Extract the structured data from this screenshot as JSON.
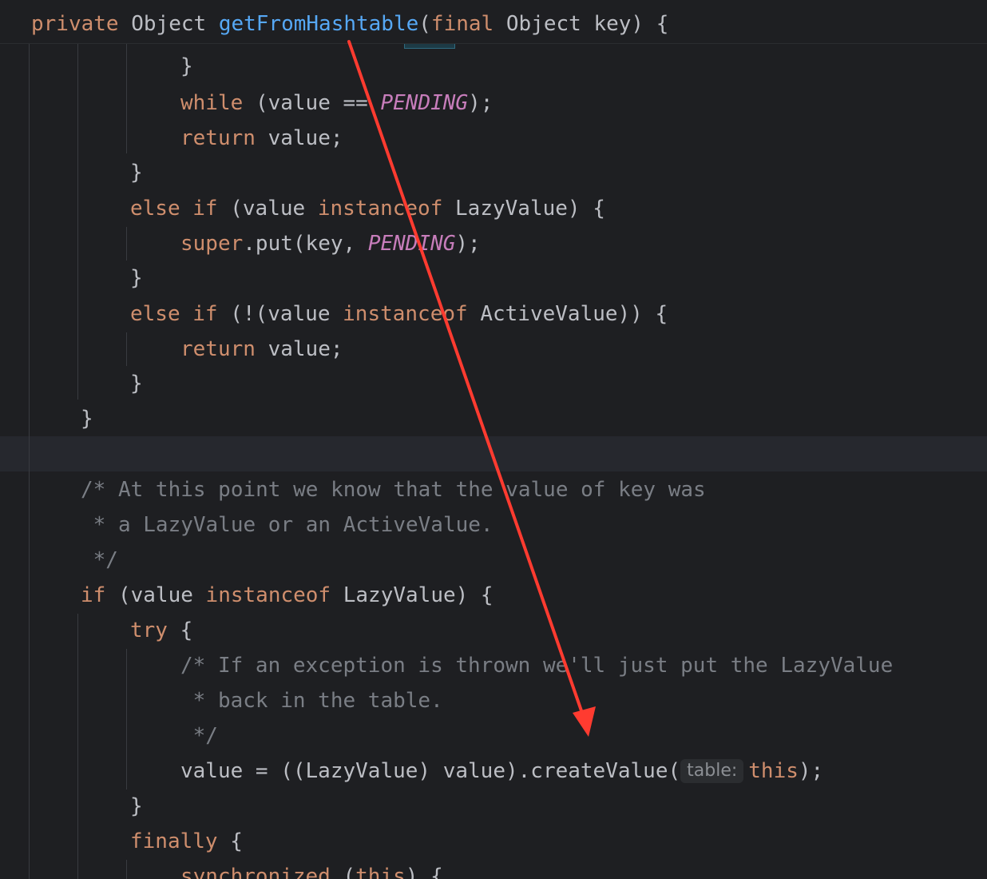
{
  "tokens": {
    "private": "private",
    "object": "Object",
    "method_name": "getFromHashtable",
    "open_paren": "(",
    "final": "final",
    "key": "key",
    "sig_close": ") {",
    "close_brace": "}",
    "while": "while",
    "value_eq": "(value ==",
    "pending": "PENDING",
    "paren_semi": ");",
    "return": "return",
    "value_semi": "value;",
    "else": "else",
    "if": "if",
    "paren_value": "(value",
    "instanceof": "instanceof",
    "lazyvalue_open": "LazyValue) {",
    "super": "super",
    "put_call": ".put(key,",
    "paren_not_value": "(!(value",
    "activevalue_open": "ActiveValue)) {",
    "comment_1": "/* At this point we know that the value of key was",
    "comment_2": " * a LazyValue or an ActiveValue.",
    "comment_3": " */",
    "try_word": "try",
    "open_brace": "{",
    "comment_4": "/* If an exception is thrown we'll just put the LazyValue",
    "comment_5": " * back in the table.",
    "comment_6": " */",
    "create_value_call": "value = ((LazyValue) value).createValue(",
    "param_hint": "table:",
    "this_word": "this",
    "finally_word": "finally",
    "synchronized_word": "synchronized",
    "paren_this": "(",
    "sync_close": ") {"
  },
  "colors": {
    "background": "#1e1f22",
    "keyword": "#cf8e6d",
    "function": "#56a8f5",
    "constant": "#c77dbb",
    "comment": "#7a7e85",
    "identifier": "#bcbec4",
    "arrow": "#ff3b30"
  }
}
